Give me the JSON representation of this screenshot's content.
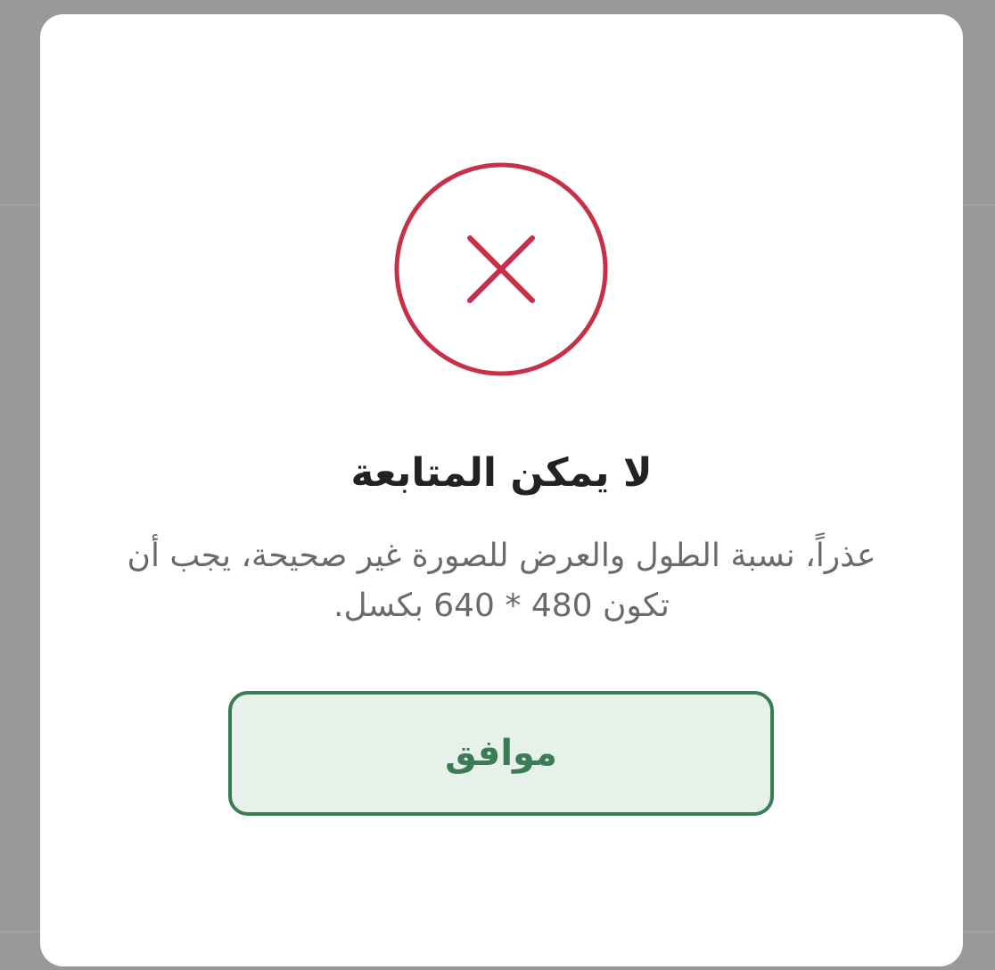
{
  "dialog": {
    "icon": "error-x-circle-icon",
    "title": "لا يمكن المتابعة",
    "message": "عذراً، نسبة الطول والعرض للصورة غير صحيحة، يجب أن تكون 480 * 640 بكسل.",
    "ok_label": "موافق"
  },
  "colors": {
    "overlay": "#999999",
    "error": "#c8304a",
    "accent": "#3a7d55",
    "button_fill": "#e6f1ea",
    "title_text": "#222222",
    "message_text": "#6a6a6a"
  }
}
